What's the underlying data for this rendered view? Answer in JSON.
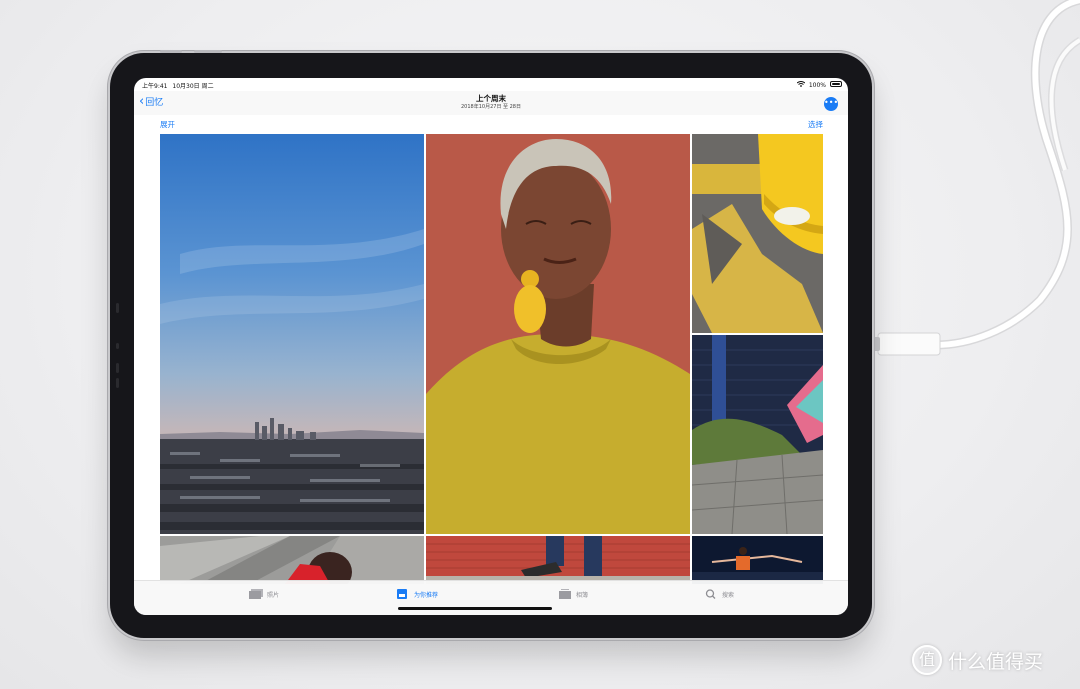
{
  "status_bar": {
    "time": "上午9:41",
    "date": "10月30日 周二",
    "battery": "100%"
  },
  "nav": {
    "back_label": "回忆",
    "title": "上个周末",
    "subtitle": "2018年10月27日 至 28日",
    "more_icon": "ellipsis-circle-icon"
  },
  "actions": {
    "expand": "展开",
    "select": "选择"
  },
  "tabs": [
    {
      "label": "照片",
      "icon": "photos-icon",
      "active": false
    },
    {
      "label": "为你推荐",
      "icon": "for-you-icon",
      "active": true
    },
    {
      "label": "相簿",
      "icon": "albums-icon",
      "active": false
    },
    {
      "label": "搜索",
      "icon": "search-icon",
      "active": false
    }
  ],
  "watermark": {
    "logo_char": "值",
    "text": "什么值得买"
  },
  "colors": {
    "accent": "#1a7cf5"
  }
}
